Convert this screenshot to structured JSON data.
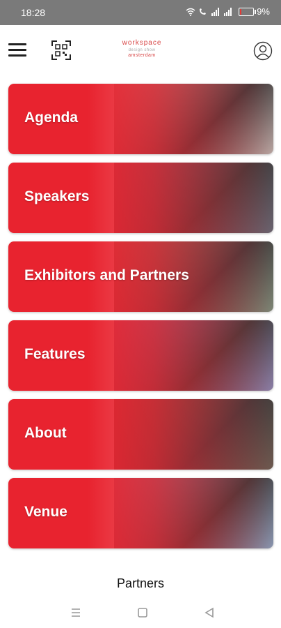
{
  "status_bar": {
    "time": "18:28",
    "battery_percent": "9%",
    "battery_level": 0.09,
    "icons": [
      "wifi-icon",
      "wifi-call-icon",
      "signal-icon",
      "signal-icon",
      "battery-icon"
    ]
  },
  "header": {
    "menu_icon": "hamburger-icon",
    "scan_icon": "qr-scan-icon",
    "logo": {
      "line1": "workspace",
      "line2": "design show",
      "line3": "amsterdam"
    },
    "profile_icon": "user-icon"
  },
  "cards": [
    {
      "label": "Agenda",
      "overlay": "#e8232f",
      "photo": "#b9a6a2"
    },
    {
      "label": "Speakers",
      "overlay": "#e8232f",
      "photo": "#6a6470"
    },
    {
      "label": "Exhibitors and Partners",
      "overlay": "#e8232f",
      "photo": "#7e8776"
    },
    {
      "label": "Features",
      "overlay": "#e8232f",
      "photo": "#8b7fa7"
    },
    {
      "label": "About",
      "overlay": "#e8232f",
      "photo": "#6d5a50"
    },
    {
      "label": "Venue",
      "overlay": "#e8232f",
      "photo": "#8a96b0"
    }
  ],
  "partners_title": "Partners",
  "nav": [
    "menu-icon",
    "home-icon",
    "back-icon"
  ],
  "colors": {
    "accent": "#e8232f",
    "status_bar": "#7a7a7a"
  }
}
